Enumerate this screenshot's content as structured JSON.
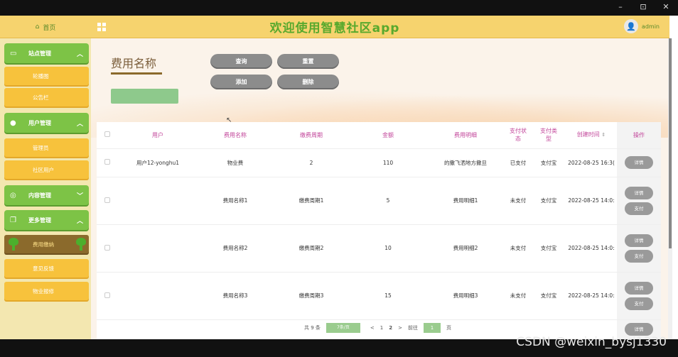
{
  "window": {
    "minimize": "–",
    "restore": "⊡",
    "close": "✕"
  },
  "header": {
    "home_label": "首页",
    "app_title": "欢迎使用智慧社区app",
    "user_name": "admin"
  },
  "sidebar": {
    "groups": [
      {
        "label": "站点管理",
        "items": [
          "轮播图",
          "公告栏"
        ]
      },
      {
        "label": "用户管理",
        "items": [
          "管理员",
          "社区用户"
        ]
      },
      {
        "label": "内容管理",
        "items": []
      },
      {
        "label": "更多管理",
        "items": [
          "费用缴纳",
          "意见反馈",
          "物业报修"
        ]
      }
    ]
  },
  "search": {
    "title": "费用名称",
    "buttons": {
      "query": "查询",
      "reset": "重置",
      "add": "添加",
      "delete": "删除"
    }
  },
  "table": {
    "headers": [
      "用户",
      "费用名称",
      "缴费周期",
      "金额",
      "费用明细",
      "支付状态",
      "支付类型",
      "创建时间",
      "操作"
    ],
    "rows": [
      {
        "user": "用户12-yonghu1",
        "name": "物业费",
        "period": "2",
        "amount": "110",
        "detail": "的撒飞洒地方撒旦",
        "status": "已支付",
        "type": "支付宝",
        "time": "2022-08-25 16:3(",
        "actions": [
          "详情"
        ]
      },
      {
        "user": "",
        "name": "费用名称1",
        "period": "缴费周期1",
        "amount": "5",
        "detail": "费用明细1",
        "status": "未支付",
        "type": "支付宝",
        "time": "2022-08-25 14:0:",
        "actions": [
          "详情",
          "支付"
        ]
      },
      {
        "user": "",
        "name": "费用名称2",
        "period": "缴费周期2",
        "amount": "10",
        "detail": "费用明细2",
        "status": "未支付",
        "type": "支付宝",
        "time": "2022-08-25 14:0:",
        "actions": [
          "详情",
          "支付"
        ]
      },
      {
        "user": "",
        "name": "费用名称3",
        "period": "缴费周期3",
        "amount": "15",
        "detail": "费用明细3",
        "status": "未支付",
        "type": "支付宝",
        "time": "2022-08-25 14:0:",
        "actions": [
          "详情",
          "支付"
        ]
      }
    ],
    "partial_action": "详情"
  },
  "pager": {
    "total": "共 9 条",
    "page_size": "7条/页",
    "prev": "<",
    "page1": "1",
    "page2": "2",
    "next": ">",
    "goto": "前往",
    "goto_value": "1",
    "page_unit": "页"
  },
  "watermark": "CSDN @weixin_bysj1330"
}
